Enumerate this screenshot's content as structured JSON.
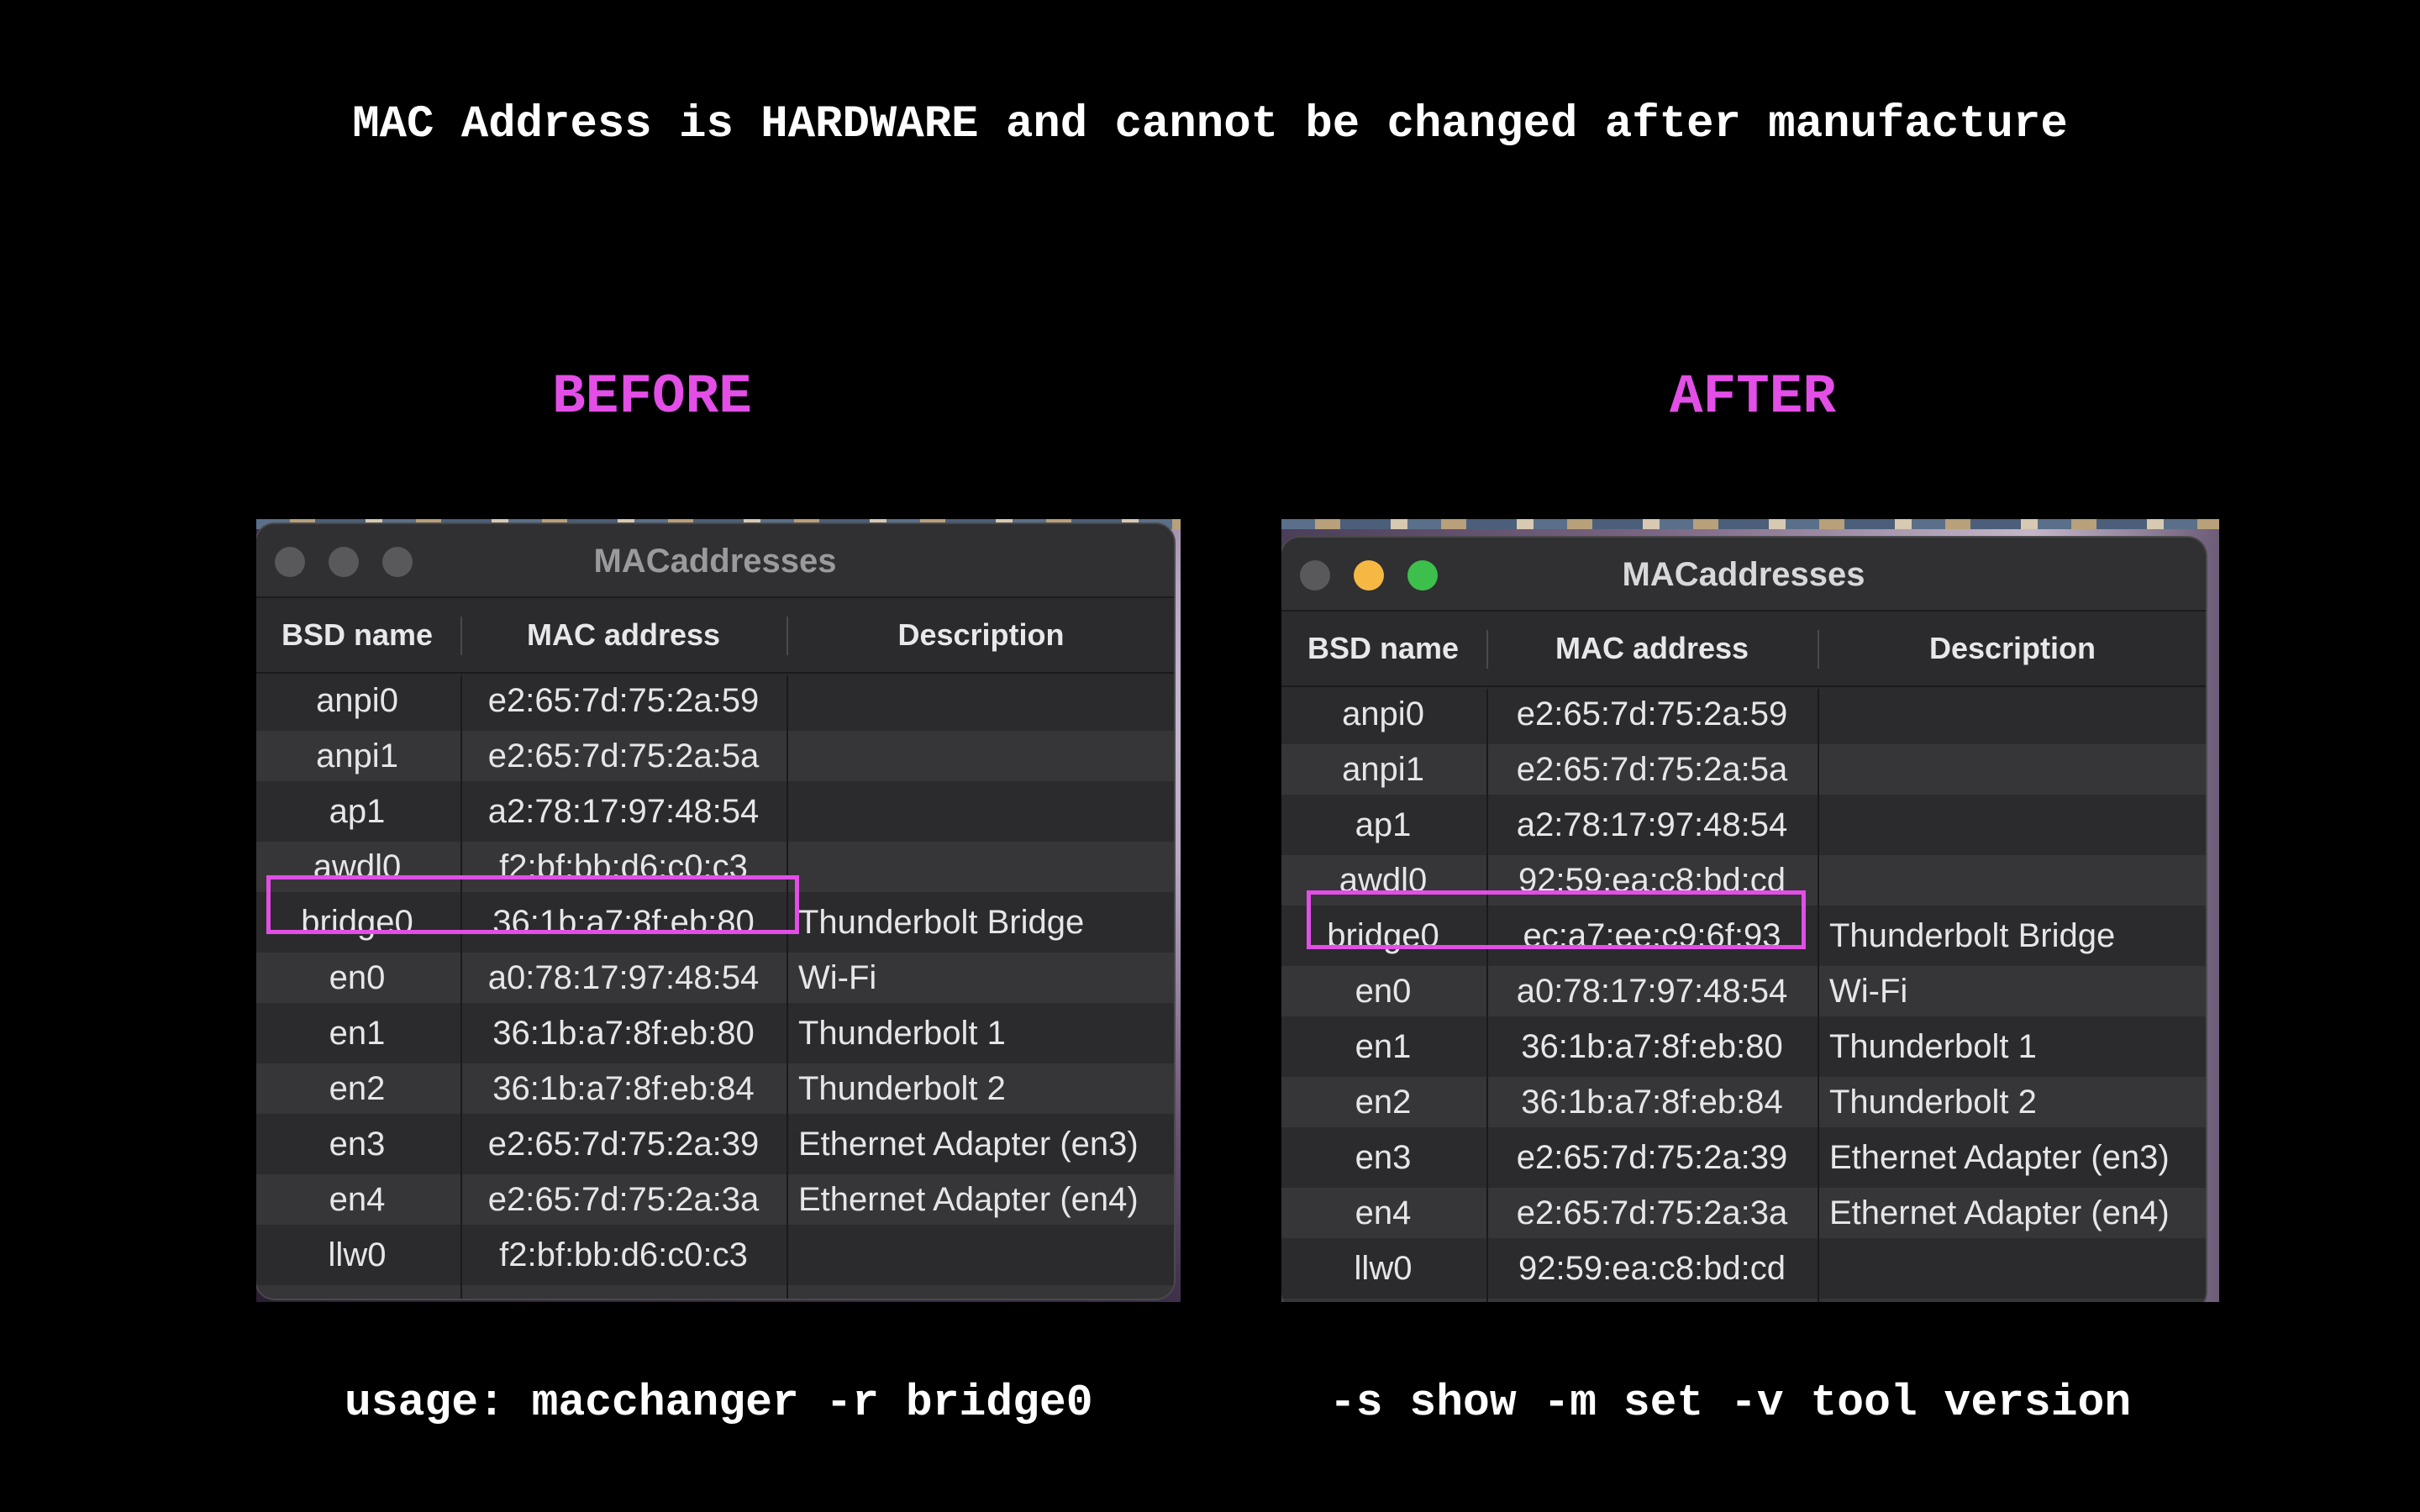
{
  "headline": "MAC Address is HARDWARE and cannot be changed after manufacture",
  "before_label": "BEFORE",
  "after_label": "AFTER",
  "footer": {
    "usage": "usage: macchanger -r bridge0",
    "options": "-s show -m set -v tool version"
  },
  "highlight_color": "#e24ee6",
  "before": {
    "window_title": "MACaddresses",
    "columns": [
      "BSD name",
      "MAC address",
      "Description"
    ],
    "rows": [
      {
        "bsd": "anpi0",
        "mac": "e2:65:7d:75:2a:59",
        "desc": ""
      },
      {
        "bsd": "anpi1",
        "mac": "e2:65:7d:75:2a:5a",
        "desc": ""
      },
      {
        "bsd": "ap1",
        "mac": "a2:78:17:97:48:54",
        "desc": ""
      },
      {
        "bsd": "awdl0",
        "mac": "f2:bf:bb:d6:c0:c3",
        "desc": ""
      },
      {
        "bsd": "bridge0",
        "mac": "36:1b:a7:8f:eb:80",
        "desc": "Thunderbolt Bridge"
      },
      {
        "bsd": "en0",
        "mac": "a0:78:17:97:48:54",
        "desc": "Wi-Fi"
      },
      {
        "bsd": "en1",
        "mac": "36:1b:a7:8f:eb:80",
        "desc": "Thunderbolt 1"
      },
      {
        "bsd": "en2",
        "mac": "36:1b:a7:8f:eb:84",
        "desc": "Thunderbolt 2"
      },
      {
        "bsd": "en3",
        "mac": "e2:65:7d:75:2a:39",
        "desc": "Ethernet Adapter (en3)"
      },
      {
        "bsd": "en4",
        "mac": "e2:65:7d:75:2a:3a",
        "desc": "Ethernet Adapter (en4)"
      },
      {
        "bsd": "llw0",
        "mac": "f2:bf:bb:d6:c0:c3",
        "desc": ""
      }
    ]
  },
  "after": {
    "window_title": "MACaddresses",
    "columns": [
      "BSD name",
      "MAC address",
      "Description"
    ],
    "rows": [
      {
        "bsd": "anpi0",
        "mac": "e2:65:7d:75:2a:59",
        "desc": ""
      },
      {
        "bsd": "anpi1",
        "mac": "e2:65:7d:75:2a:5a",
        "desc": ""
      },
      {
        "bsd": "ap1",
        "mac": "a2:78:17:97:48:54",
        "desc": ""
      },
      {
        "bsd": "awdl0",
        "mac": "92:59:ea:c8:bd:cd",
        "desc": ""
      },
      {
        "bsd": "bridge0",
        "mac": "ec:a7:ee:c9:6f:93",
        "desc": "Thunderbolt Bridge"
      },
      {
        "bsd": "en0",
        "mac": "a0:78:17:97:48:54",
        "desc": "Wi-Fi"
      },
      {
        "bsd": "en1",
        "mac": "36:1b:a7:8f:eb:80",
        "desc": "Thunderbolt 1"
      },
      {
        "bsd": "en2",
        "mac": "36:1b:a7:8f:eb:84",
        "desc": "Thunderbolt 2"
      },
      {
        "bsd": "en3",
        "mac": "e2:65:7d:75:2a:39",
        "desc": "Ethernet Adapter (en3)"
      },
      {
        "bsd": "en4",
        "mac": "e2:65:7d:75:2a:3a",
        "desc": "Ethernet Adapter (en4)"
      },
      {
        "bsd": "llw0",
        "mac": "92:59:ea:c8:bd:cd",
        "desc": ""
      }
    ]
  }
}
